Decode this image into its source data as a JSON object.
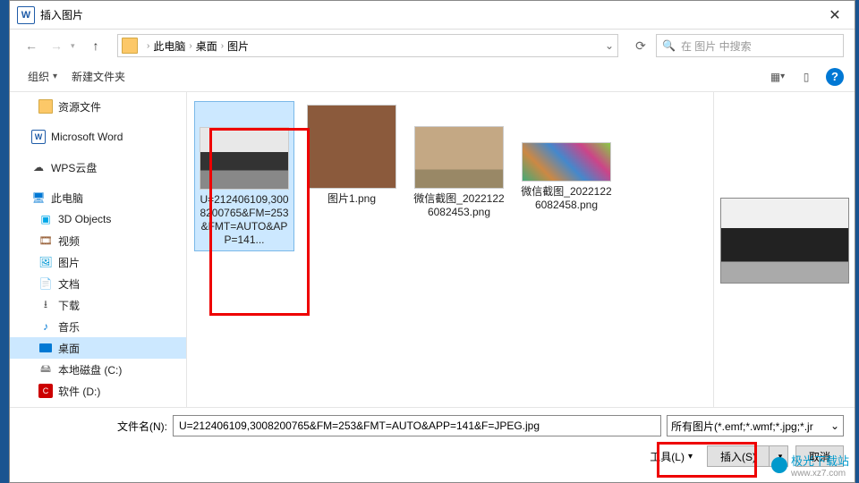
{
  "title": "插入图片",
  "breadcrumb": {
    "parts": [
      "此电脑",
      "桌面",
      "图片"
    ]
  },
  "search": {
    "placeholder": "在 图片 中搜索"
  },
  "toolbar": {
    "organize": "组织",
    "new_folder": "新建文件夹"
  },
  "sidebar": {
    "items": [
      {
        "label": "资源文件",
        "icon": "folder",
        "level": 1
      },
      {
        "label": "Microsoft Word",
        "icon": "word",
        "level": 0
      },
      {
        "label": "WPS云盘",
        "icon": "cloud",
        "level": 0
      },
      {
        "label": "此电脑",
        "icon": "pc",
        "level": 0
      },
      {
        "label": "3D Objects",
        "icon": "3d",
        "level": 1
      },
      {
        "label": "视频",
        "icon": "video",
        "level": 1
      },
      {
        "label": "图片",
        "icon": "pic",
        "level": 1
      },
      {
        "label": "文档",
        "icon": "doc",
        "level": 1
      },
      {
        "label": "下载",
        "icon": "dl",
        "level": 1
      },
      {
        "label": "音乐",
        "icon": "music",
        "level": 1
      },
      {
        "label": "桌面",
        "icon": "desktop",
        "level": 1,
        "selected": true
      },
      {
        "label": "本地磁盘 (C:)",
        "icon": "disk",
        "level": 1
      },
      {
        "label": "软件 (D:)",
        "icon": "red",
        "level": 1
      }
    ]
  },
  "files": [
    {
      "name": "U=212406109,3008200765&FM=253&FMT=AUTO&APP=141...",
      "thumb": "t1",
      "selected": true
    },
    {
      "name": "图片1.png",
      "thumb": "t2"
    },
    {
      "name": "微信截图_20221226082453.png",
      "thumb": "t3"
    },
    {
      "name": "微信截图_20221226082458.png",
      "thumb": "t4"
    }
  ],
  "bottom": {
    "filename_label": "文件名(N):",
    "filename_value": "U=212406109,3008200765&FM=253&FMT=AUTO&APP=141&F=JPEG.jpg",
    "filter": "所有图片(*.emf;*.wmf;*.jpg;*.jr",
    "tools": "工具(L)",
    "insert": "插入(S)",
    "cancel": "取消"
  },
  "watermark": {
    "text": "极光下载站",
    "url": "www.xz7.com"
  }
}
